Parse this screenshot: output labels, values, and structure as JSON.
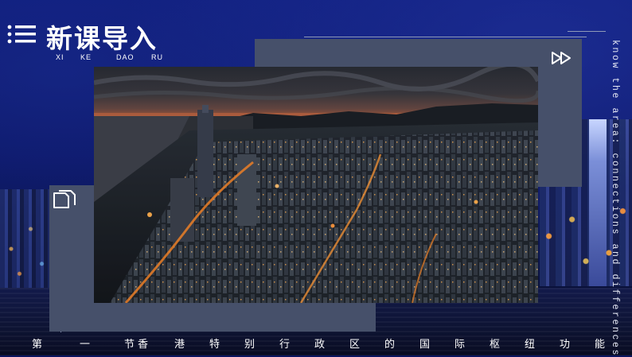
{
  "header": {
    "title": "新课导入",
    "pinyin": [
      "XI",
      "KE",
      "DAO",
      "RU"
    ]
  },
  "side_text": "know the area: connections and differences",
  "subtitle_chars": [
    "第",
    "一",
    "节",
    "香",
    "港",
    "特",
    "别",
    "行",
    "政",
    "区",
    "的",
    "国",
    "际",
    "枢",
    "纽",
    "功",
    "能"
  ],
  "icons": {
    "menu": "menu-list-icon",
    "play": "double-chevron-right-icon",
    "document": "document-icon"
  },
  "colors": {
    "background": "#0b1560",
    "panel": "#46506a",
    "accent_orange": "#ff8a2a"
  }
}
